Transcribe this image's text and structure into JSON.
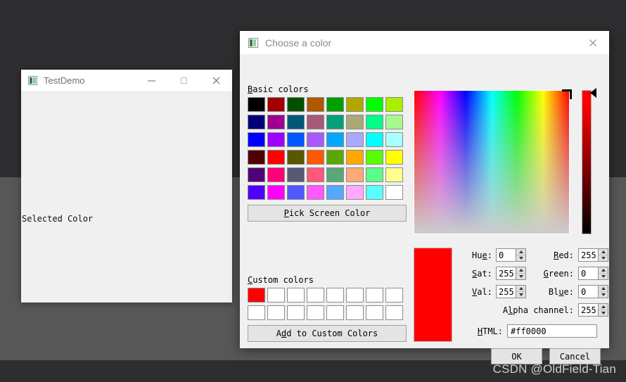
{
  "desktop": {
    "watermark": "CSDN @OldField-Tian",
    "bg_dark": "#2e2e30",
    "bg_mid": "#575758"
  },
  "test_window": {
    "title": "TestDemo",
    "icon": "app-icon",
    "minimize": "—",
    "maximize": "□",
    "close": "✕",
    "label": "Selected Color"
  },
  "dialog": {
    "title": "Choose a color",
    "icon": "app-icon",
    "close": "✕",
    "basic_colors_label": "Basic colors",
    "basic_colors_mnemonic": "B",
    "basic_colors_rest": "asic colors",
    "basic_colors": [
      "#000000",
      "#a00000",
      "#005000",
      "#b05800",
      "#00a000",
      "#b0a800",
      "#00ff00",
      "#a8f000",
      "#000078",
      "#a00090",
      "#005878",
      "#a85878",
      "#00a078",
      "#a8a878",
      "#00ff88",
      "#a8f890",
      "#0000ff",
      "#a000ff",
      "#0058ff",
      "#a858ff",
      "#00a8ff",
      "#a8a8ff",
      "#00ffff",
      "#a8ffff",
      "#500000",
      "#ff0000",
      "#585800",
      "#ff5800",
      "#58a800",
      "#ffa800",
      "#58ff00",
      "#ffff00",
      "#500078",
      "#ff0078",
      "#585878",
      "#ff5878",
      "#58a878",
      "#ffa878",
      "#58ff88",
      "#ffff90",
      "#5000ff",
      "#ff00ff",
      "#5058ff",
      "#ff58ff",
      "#58a8ff",
      "#ffa8ff",
      "#58ffff",
      "#ffffff"
    ],
    "pick_screen_color": {
      "mnemonic": "P",
      "rest": "ick Screen Color"
    },
    "custom_colors_label": {
      "mnemonic": "C",
      "rest": "ustom colors"
    },
    "custom_colors": [
      "#ff0000",
      "#ffffff",
      "#ffffff",
      "#ffffff",
      "#ffffff",
      "#ffffff",
      "#ffffff",
      "#ffffff",
      "#ffffff",
      "#ffffff",
      "#ffffff",
      "#ffffff",
      "#ffffff",
      "#ffffff",
      "#ffffff",
      "#ffffff"
    ],
    "add_to_custom_colors": {
      "pre": "A",
      "mnemonic": "d",
      "rest": "d to Custom Colors"
    },
    "preview_color": "#ff0000",
    "fields": {
      "hue": {
        "pre": "Hu",
        "mnemonic": "e",
        "post": ":",
        "value": "0"
      },
      "sat": {
        "pre": "",
        "mnemonic": "S",
        "post": "at:",
        "value": "255"
      },
      "val": {
        "pre": "",
        "mnemonic": "V",
        "post": "al:",
        "value": "255"
      },
      "red": {
        "pre": "",
        "mnemonic": "R",
        "post": "ed:",
        "value": "255"
      },
      "green": {
        "pre": "",
        "mnemonic": "G",
        "post": "reen:",
        "value": "0"
      },
      "blue": {
        "pre": "Bl",
        "mnemonic": "u",
        "post": "e:",
        "value": "0"
      },
      "alpha": {
        "pre": "A",
        "mnemonic": "l",
        "post": "pha channel:",
        "value": "255"
      },
      "html": {
        "pre": "",
        "mnemonic": "H",
        "post": "TML:",
        "value": "#ff0000"
      }
    },
    "buttons": {
      "ok": "OK",
      "cancel": "Cancel"
    }
  }
}
